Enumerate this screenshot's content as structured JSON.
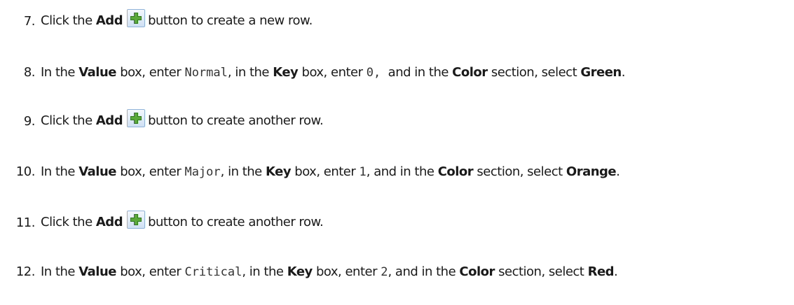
{
  "steps": [
    {
      "number": "7.",
      "segments": [
        {
          "t": "text",
          "v": "Click the "
        },
        {
          "t": "bold",
          "v": "Add"
        },
        {
          "t": "icon",
          "v": "add-icon"
        },
        {
          "t": "text",
          "v": "button to create a new row."
        }
      ]
    },
    {
      "number": "8.",
      "segments": [
        {
          "t": "text",
          "v": "In the "
        },
        {
          "t": "bold",
          "v": "Value"
        },
        {
          "t": "text",
          "v": " box, enter "
        },
        {
          "t": "code",
          "v": "Normal"
        },
        {
          "t": "text",
          "v": ", in the "
        },
        {
          "t": "bold",
          "v": "Key"
        },
        {
          "t": "text",
          "v": " box, enter "
        },
        {
          "t": "code",
          "v": "0,"
        },
        {
          "t": "text",
          "v": "  and in the "
        },
        {
          "t": "bold",
          "v": "Color"
        },
        {
          "t": "text",
          "v": " section, select "
        },
        {
          "t": "bold",
          "v": "Green"
        },
        {
          "t": "text",
          "v": "."
        }
      ]
    },
    {
      "number": "9.",
      "segments": [
        {
          "t": "text",
          "v": "Click the "
        },
        {
          "t": "bold",
          "v": "Add"
        },
        {
          "t": "icon",
          "v": "add-icon"
        },
        {
          "t": "text",
          "v": "button to create another row."
        }
      ]
    },
    {
      "number": "10.",
      "segments": [
        {
          "t": "text",
          "v": "In the "
        },
        {
          "t": "bold",
          "v": "Value"
        },
        {
          "t": "text",
          "v": " box, enter "
        },
        {
          "t": "code",
          "v": "Major"
        },
        {
          "t": "text",
          "v": ", in the "
        },
        {
          "t": "bold",
          "v": "Key"
        },
        {
          "t": "text",
          "v": " box, enter "
        },
        {
          "t": "code",
          "v": "1"
        },
        {
          "t": "text",
          "v": ", and in the "
        },
        {
          "t": "bold",
          "v": "Color"
        },
        {
          "t": "text",
          "v": " section, select "
        },
        {
          "t": "bold",
          "v": "Orange"
        },
        {
          "t": "text",
          "v": "."
        }
      ]
    },
    {
      "number": "11.",
      "segments": [
        {
          "t": "text",
          "v": "Click the "
        },
        {
          "t": "bold",
          "v": "Add"
        },
        {
          "t": "icon",
          "v": "add-icon"
        },
        {
          "t": "text",
          "v": "button to create another row."
        }
      ]
    },
    {
      "number": "12.",
      "segments": [
        {
          "t": "text",
          "v": "In the "
        },
        {
          "t": "bold",
          "v": "Value"
        },
        {
          "t": "text",
          "v": " box, enter "
        },
        {
          "t": "code",
          "v": "Critical"
        },
        {
          "t": "text",
          "v": ", in the "
        },
        {
          "t": "bold",
          "v": "Key"
        },
        {
          "t": "text",
          "v": " box, enter "
        },
        {
          "t": "code",
          "v": "2"
        },
        {
          "t": "text",
          "v": ", and in the "
        },
        {
          "t": "bold",
          "v": "Color"
        },
        {
          "t": "text",
          "v": " section, select "
        },
        {
          "t": "bold",
          "v": "Red"
        },
        {
          "t": "text",
          "v": "."
        }
      ]
    }
  ],
  "colors": {
    "text": "#1a1a1a",
    "icon_plus_fill": "#5aa83a",
    "icon_plus_stroke": "#2f7a1f",
    "icon_border": "#8fb3d9"
  }
}
